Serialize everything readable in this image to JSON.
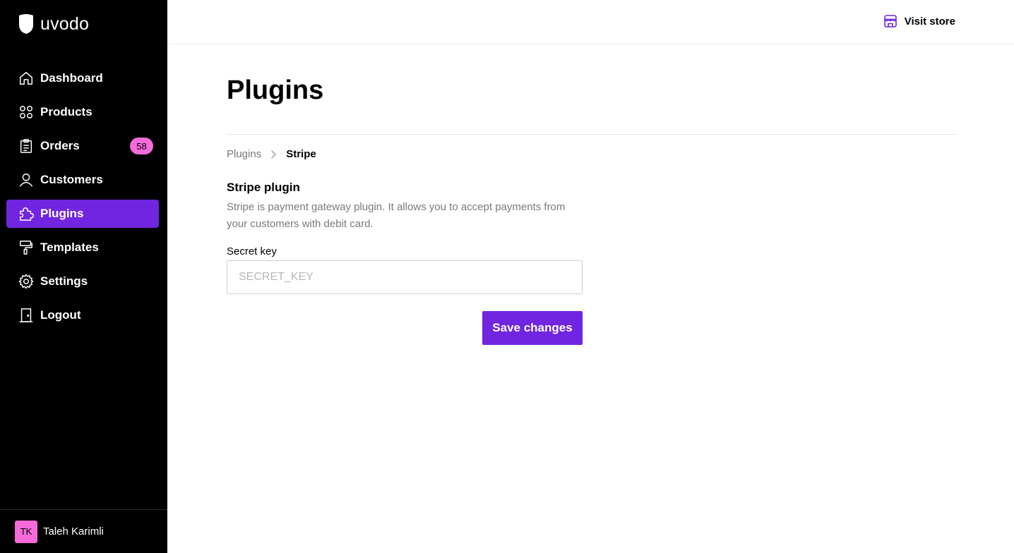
{
  "brand": {
    "name": "uvodo",
    "icon": "shield-logo-icon"
  },
  "colors": {
    "accent": "#7125e0",
    "badge": "#f66ad9",
    "sidebar_bg": "#000000"
  },
  "sidebar": {
    "items": [
      {
        "label": "Dashboard",
        "icon": "home-icon"
      },
      {
        "label": "Products",
        "icon": "grid-icon"
      },
      {
        "label": "Orders",
        "icon": "clipboard-icon",
        "badge": "58"
      },
      {
        "label": "Customers",
        "icon": "user-icon"
      },
      {
        "label": "Plugins",
        "icon": "puzzle-icon",
        "active": true
      },
      {
        "label": "Templates",
        "icon": "paint-roller-icon"
      },
      {
        "label": "Settings",
        "icon": "gear-icon"
      },
      {
        "label": "Logout",
        "icon": "door-icon"
      }
    ]
  },
  "user": {
    "initials": "TK",
    "name": "Taleh Karimli"
  },
  "topbar": {
    "visit_store_label": "Visit store",
    "visit_store_icon": "store-icon"
  },
  "page": {
    "title": "Plugins"
  },
  "breadcrumb": {
    "parent": "Plugins",
    "current": "Stripe"
  },
  "plugin": {
    "title": "Stripe plugin",
    "description": "Stripe is payment gateway plugin. It allows you to accept payments from your customers with debit card.",
    "secret_key_label": "Secret key",
    "secret_key_value": "",
    "secret_key_placeholder": "SECRET_KEY",
    "save_label": "Save changes"
  }
}
